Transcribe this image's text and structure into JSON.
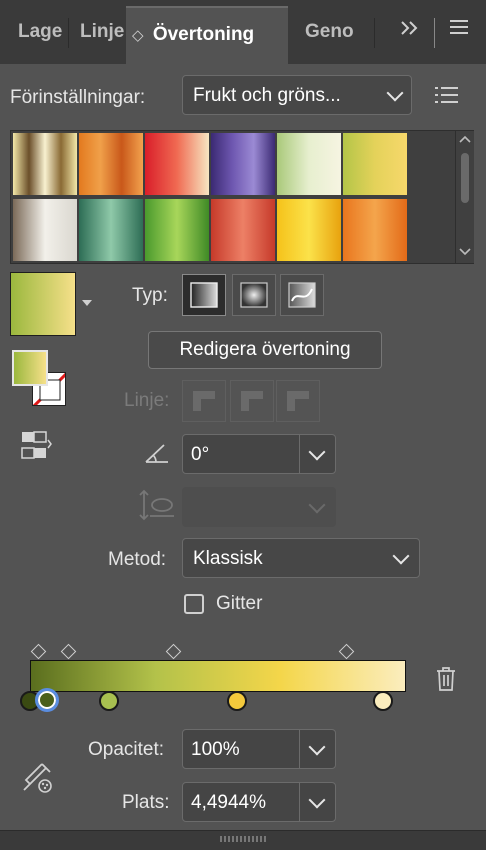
{
  "tabs": [
    {
      "label": "Lage"
    },
    {
      "label": "Linje"
    },
    {
      "label": "Övertoning",
      "active_marker": "◇"
    },
    {
      "label": "Geno"
    }
  ],
  "tabbar_icons": {
    "expand": "chevrons-right-icon",
    "menu": "hamburger-menu-icon"
  },
  "presets": {
    "label": "Förinställningar:",
    "value": "Frukt och gröns..."
  },
  "swatches": [
    {
      "colors": [
        "#f2e7a8",
        "#6b4f2a",
        "#f8f1d0",
        "#8a6a34",
        "#f2e7a8"
      ]
    },
    {
      "colors": [
        "#e37a1f",
        "#f0a04a",
        "#c9581a",
        "#f3a24e"
      ]
    },
    {
      "colors": [
        "#d91e2a",
        "#f06a52",
        "#f7e6c2"
      ]
    },
    {
      "colors": [
        "#3b2a73",
        "#6e57b0",
        "#9b8ad4",
        "#3b2a73"
      ]
    },
    {
      "colors": [
        "#a9c97a",
        "#e7efcf",
        "#f6f4e2"
      ]
    },
    {
      "colors": [
        "#b4c548",
        "#e4d25a",
        "#f7d86b"
      ]
    },
    {
      "colors": [
        "#7b6a58",
        "#f2f0ea",
        "#dad7cf"
      ]
    },
    {
      "colors": [
        "#2d6d55",
        "#8fc9a9",
        "#2d6d55"
      ]
    },
    {
      "colors": [
        "#4a9a2d",
        "#a8d65a",
        "#3f8a26"
      ]
    },
    {
      "colors": [
        "#c63a2a",
        "#ed8066",
        "#c63a2a"
      ]
    },
    {
      "colors": [
        "#f5c21a",
        "#fbe24a",
        "#e8a20e"
      ]
    },
    {
      "colors": [
        "#e9761e",
        "#f4a54c",
        "#e36a18"
      ]
    }
  ],
  "current_gradient": {
    "from": "#9bb83e",
    "to": "#f6e08a"
  },
  "type_row": {
    "label": "Typ:"
  },
  "edit_button": {
    "label": "Redigera övertoning"
  },
  "stroke_row": {
    "label": "Linje:"
  },
  "angle": {
    "value": "0°",
    "icon": "angle-icon"
  },
  "aspect_icon": "aspect-ratio-icon",
  "method": {
    "label": "Metod:",
    "value": "Klassisk"
  },
  "grid_checkbox": {
    "label": "Gitter",
    "checked": false
  },
  "gradient_slider": {
    "colors": [
      "#5a6e1e",
      "#b3c24a",
      "#f4d64a",
      "#fbedbe"
    ],
    "stops": [
      {
        "position": 0.0,
        "color": "#3a4a12"
      },
      {
        "position": 0.045,
        "color": "#4b5f1a",
        "selected": true
      },
      {
        "position": 0.21,
        "color": "#a8c050"
      },
      {
        "position": 0.55,
        "color": "#f3c93c"
      },
      {
        "position": 0.94,
        "color": "#fbedbe"
      }
    ],
    "midpoints": [
      0.02,
      0.1,
      0.38,
      0.84
    ]
  },
  "delete_icon": "trash-icon",
  "eyedropper_icon": "eyedropper-icon",
  "opacity": {
    "label": "Opacitet:",
    "value": "100%"
  },
  "location": {
    "label": "Plats:",
    "value": "4,4944%"
  }
}
